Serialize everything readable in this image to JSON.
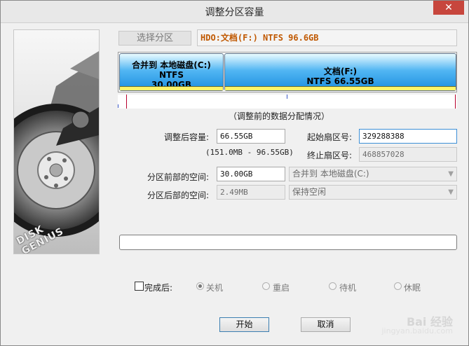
{
  "window": {
    "title": "调整分区容量",
    "close_glyph": "✕"
  },
  "image_panel": {
    "brand": "DISK GENIUS"
  },
  "top": {
    "select_partition_label": "选择分区",
    "partition_value": "HDO:文档(F:) NTFS 96.6GB"
  },
  "partitions": [
    {
      "name": "合并到 本地磁盘(C:)",
      "fs": "NTFS",
      "size": "30.00GB"
    },
    {
      "name": "文档(F:)",
      "fs": "NTFS 66.55GB",
      "size": ""
    }
  ],
  "caption": "（调整前的数据分配情况）",
  "form": {
    "new_size_label": "调整后容量:",
    "new_size_value": "66.55GB",
    "range_text": "(151.0MB - 96.55GB)",
    "start_sector_label": "起始扇区号:",
    "start_sector_value": "329288388",
    "end_sector_label": "终止扇区号:",
    "end_sector_value": "468857028",
    "before_space_label": "分区前部的空间:",
    "before_space_value": "30.00GB",
    "before_space_action": "合并到 本地磁盘(C:)",
    "after_space_label": "分区后部的空间:",
    "after_space_value": "2.49MB",
    "after_space_action": "保持空闲"
  },
  "progress": {
    "value": 0
  },
  "completion": {
    "label": "完成后:",
    "options": [
      "关机",
      "重启",
      "待机",
      "休眠"
    ],
    "selected": "关机"
  },
  "buttons": {
    "start": "开始",
    "cancel": "取消"
  },
  "watermark": {
    "line1": "Bai 经验",
    "line2": "jingyan.baidu.com"
  }
}
